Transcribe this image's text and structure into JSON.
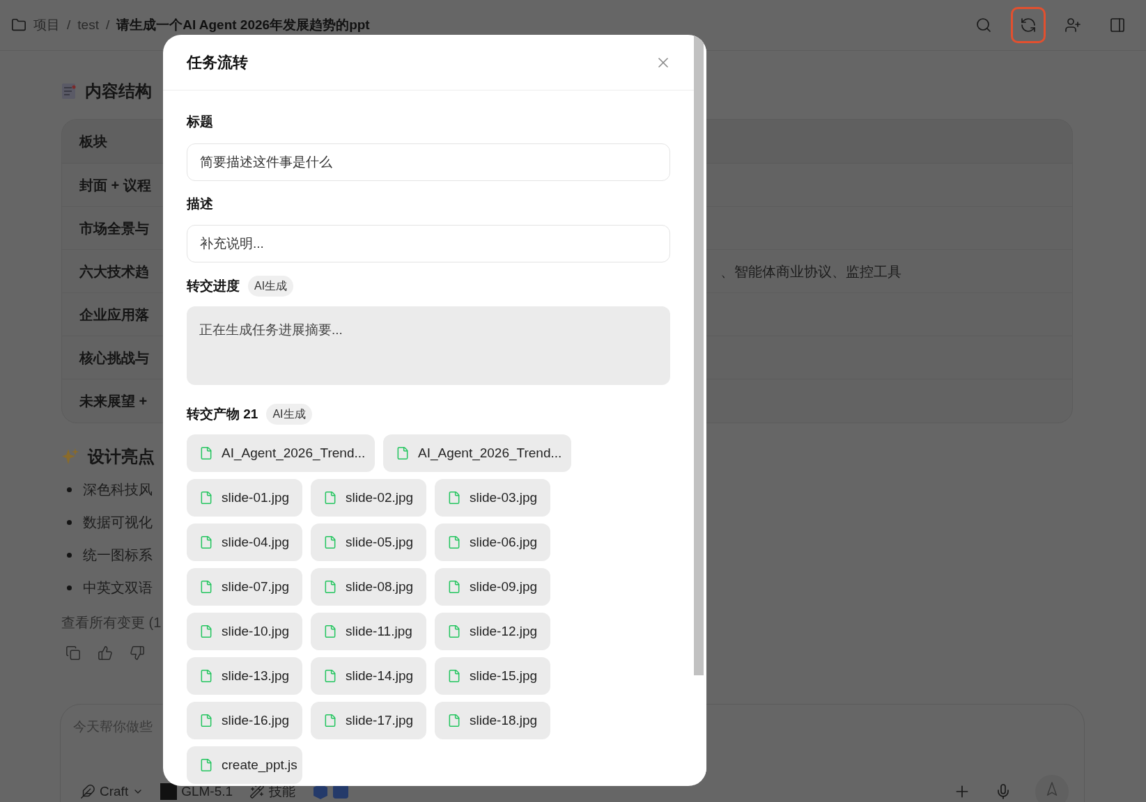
{
  "breadcrumb": [
    {
      "label": "项目",
      "current": false
    },
    {
      "label": "test",
      "current": false
    },
    {
      "label": "请生成一个AI Agent 2026年发展趋势的ppt",
      "current": true
    }
  ],
  "breadcrumb_separator": "/",
  "toolbar": [
    {
      "kind": "search",
      "highlighted": false
    },
    {
      "kind": "sync",
      "highlighted": true
    },
    {
      "kind": "add-user",
      "highlighted": false
    },
    {
      "kind": "panel",
      "highlighted": false
    }
  ],
  "structure": {
    "title": "内容结构",
    "header": "板块",
    "rows": [
      {
        "label": "封面 + 议程"
      },
      {
        "label": "市场全景与"
      },
      {
        "label": "六大技术趋",
        "detail": "、智能体商业协议、监控工具"
      },
      {
        "label": "企业应用落"
      },
      {
        "label": "核心挑战与"
      },
      {
        "label": "未来展望 +"
      }
    ]
  },
  "highlights": {
    "title": "设计亮点",
    "items": [
      "深色科技风",
      "数据可视化",
      "统一图标系",
      "中英文双语"
    ]
  },
  "changes_link": "查看所有变更 (1",
  "composer": {
    "placeholder": "今天帮你做些",
    "mode": "Craft",
    "model": "GLM-5.1",
    "skills": "技能"
  },
  "modal": {
    "title": "任务流转",
    "fields": [
      {
        "label": "标题",
        "placeholder": "简要描述这件事是什么"
      },
      {
        "label": "描述",
        "placeholder": "补充说明..."
      }
    ],
    "progress": {
      "label": "转交进度",
      "badge": "AI生成",
      "text": "正在生成任务进展摘要..."
    },
    "artifacts": {
      "label": "转交产物 21",
      "badge": "AI生成",
      "files": [
        {
          "name": "AI_Agent_2026_Trend...",
          "kind": "wide"
        },
        {
          "name": "AI_Agent_2026_Trend...",
          "kind": "wide"
        },
        {
          "name": "slide-01.jpg",
          "kind": "normal"
        },
        {
          "name": "slide-02.jpg",
          "kind": "normal"
        },
        {
          "name": "slide-03.jpg",
          "kind": "normal"
        },
        {
          "name": "slide-04.jpg",
          "kind": "normal"
        },
        {
          "name": "slide-05.jpg",
          "kind": "normal"
        },
        {
          "name": "slide-06.jpg",
          "kind": "normal"
        },
        {
          "name": "slide-07.jpg",
          "kind": "normal"
        },
        {
          "name": "slide-08.jpg",
          "kind": "normal"
        },
        {
          "name": "slide-09.jpg",
          "kind": "normal"
        },
        {
          "name": "slide-10.jpg",
          "kind": "normal"
        },
        {
          "name": "slide-11.jpg",
          "kind": "normal"
        },
        {
          "name": "slide-12.jpg",
          "kind": "normal"
        },
        {
          "name": "slide-13.jpg",
          "kind": "normal"
        },
        {
          "name": "slide-14.jpg",
          "kind": "normal"
        },
        {
          "name": "slide-15.jpg",
          "kind": "normal"
        },
        {
          "name": "slide-16.jpg",
          "kind": "normal"
        },
        {
          "name": "slide-17.jpg",
          "kind": "normal"
        },
        {
          "name": "slide-18.jpg",
          "kind": "normal"
        },
        {
          "name": "create_ppt.js",
          "kind": "normal"
        }
      ]
    }
  }
}
